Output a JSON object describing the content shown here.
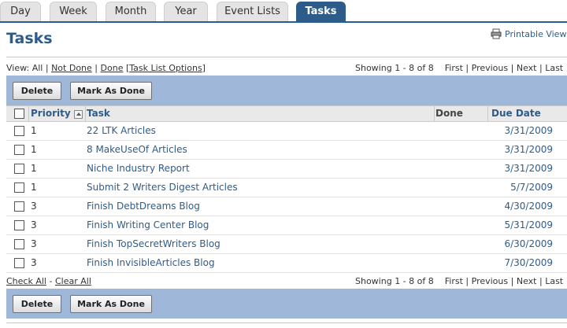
{
  "tabs": [
    "Day",
    "Week",
    "Month",
    "Year",
    "Event Lists",
    "Tasks"
  ],
  "active_tab": "Tasks",
  "page_title": "Tasks",
  "printable_view": "Printable View",
  "filter": {
    "view_label": "View:",
    "all": "All",
    "sep1": "|",
    "not_done": "Not Done",
    "sep2": "|",
    "done": "Done",
    "options_open": "[",
    "options": "Task List Options",
    "options_close": "]"
  },
  "pager": {
    "showing": "Showing 1 - 8 of 8",
    "first": "First",
    "sep1": "|",
    "previous": "Previous",
    "sep2": "|",
    "next": "Next",
    "sep3": "|",
    "last": "Last"
  },
  "actions": {
    "delete": "Delete",
    "mark_done": "Mark As Done"
  },
  "table": {
    "headers": {
      "priority": "Priority",
      "task": "Task",
      "done": "Done",
      "due_date": "Due Date"
    },
    "rows": [
      {
        "priority": "1",
        "task": "22 LTK Articles",
        "done": "",
        "due": "3/31/2009"
      },
      {
        "priority": "1",
        "task": "8 MakeUseOf Articles",
        "done": "",
        "due": "3/31/2009"
      },
      {
        "priority": "1",
        "task": "Niche Industry Report",
        "done": "",
        "due": "3/31/2009"
      },
      {
        "priority": "1",
        "task": "Submit 2 Writers Digest Articles",
        "done": "",
        "due": "5/7/2009"
      },
      {
        "priority": "3",
        "task": "Finish DebtDreams Blog",
        "done": "",
        "due": "4/30/2009"
      },
      {
        "priority": "3",
        "task": "Finish Writing Center Blog",
        "done": "",
        "due": "5/31/2009"
      },
      {
        "priority": "3",
        "task": "Finish TopSecretWriters Blog",
        "done": "",
        "due": "6/30/2009"
      },
      {
        "priority": "3",
        "task": "Finish InvisibleArticles Blog",
        "done": "",
        "due": "7/30/2009"
      }
    ]
  },
  "footer": {
    "check_all": "Check All",
    "dash": "-",
    "clear_all": "Clear All"
  },
  "colors": {
    "accent": "#2e5c8a",
    "action_bar": "#9fb7d8",
    "header_bg": "#e9e9e9"
  }
}
